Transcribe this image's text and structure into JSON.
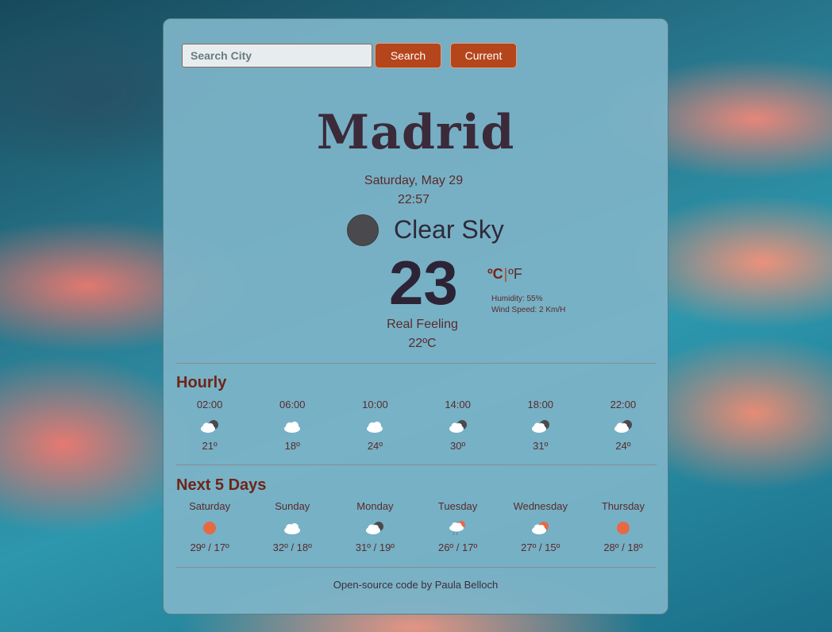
{
  "search": {
    "placeholder": "Search City",
    "value": ""
  },
  "buttons": {
    "search": "Search",
    "current": "Current"
  },
  "city": "Madrid",
  "date": "Saturday, May 29",
  "time": "22:57",
  "condition": {
    "icon": "moon-icon",
    "description": "Clear Sky"
  },
  "temperature": "23",
  "units": {
    "celsius": "ºC",
    "separator": "|",
    "fahrenheit": "ºF"
  },
  "humidity": "Humidity: 55%",
  "wind": "Wind Speed: 2 Km/H",
  "real_feeling": {
    "label": "Real Feeling",
    "value": "22ºC"
  },
  "hourly": {
    "title": "Hourly",
    "items": [
      {
        "time": "02:00",
        "icon": "night-cloudy-icon",
        "temp": "21º"
      },
      {
        "time": "06:00",
        "icon": "cloud-icon",
        "temp": "18º"
      },
      {
        "time": "10:00",
        "icon": "cloud-icon",
        "temp": "24º"
      },
      {
        "time": "14:00",
        "icon": "night-cloudy-icon",
        "temp": "30º"
      },
      {
        "time": "18:00",
        "icon": "night-cloudy-icon",
        "temp": "31º"
      },
      {
        "time": "22:00",
        "icon": "night-cloudy-icon",
        "temp": "24º"
      }
    ]
  },
  "daily": {
    "title": "Next 5 Days",
    "items": [
      {
        "day": "Saturday",
        "icon": "sun-icon",
        "temp": "29º / 17º"
      },
      {
        "day": "Sunday",
        "icon": "cloud-icon",
        "temp": "32º / 18º"
      },
      {
        "day": "Monday",
        "icon": "night-cloudy-icon",
        "temp": "31º / 19º"
      },
      {
        "day": "Tuesday",
        "icon": "sun-rain-cloud-icon",
        "temp": "26º / 17º"
      },
      {
        "day": "Wednesday",
        "icon": "sun-cloud-icon",
        "temp": "27º / 15º"
      },
      {
        "day": "Thursday",
        "icon": "sun-icon",
        "temp": "28º / 18º"
      }
    ]
  },
  "footer": "Open-source code by Paula Belloch",
  "colors": {
    "accent": "#b5451b",
    "card": "#7db4c8",
    "title_text": "#3b2a3a",
    "section_title": "#6e2518"
  }
}
